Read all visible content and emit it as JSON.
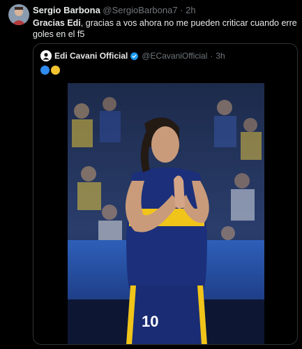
{
  "tweet": {
    "author_name": "Sergio Barbona",
    "author_handle": "@SergioBarbona7",
    "separator": "·",
    "time": "2h",
    "text_bold": "Gracias Edi",
    "text_rest": ", gracias a vos ahora no me pueden criticar cuando erre goles en el f5"
  },
  "quoted": {
    "author_name": "Edi Cavani Official",
    "author_handle": "@ECavaniOfficial",
    "separator": "·",
    "time": "3h",
    "emoji_colors": [
      "#2f8bf0",
      "#f4c430"
    ],
    "photo_alt": "Football player in blue and yellow kit applauding",
    "jersey_number": "10"
  },
  "colors": {
    "background": "#000000",
    "text": "#e7e9ea",
    "muted": "#71767b",
    "border": "#2f3336",
    "verified": "#1d9bf0"
  }
}
